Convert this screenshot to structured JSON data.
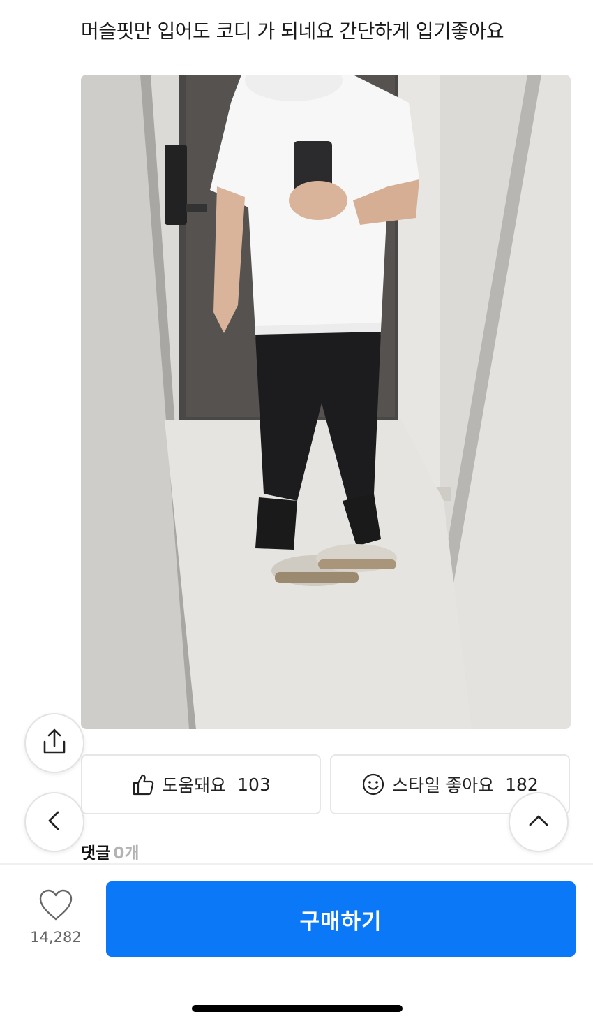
{
  "review": {
    "text": "머슬핏만 입어도 코디 가 되네요 간단하게 입기좋아요"
  },
  "reactions": {
    "helpful": {
      "label": "도움돼요",
      "count": "103",
      "icon": "thumbs-up-icon"
    },
    "style": {
      "label": "스타일 좋아요",
      "count": "182",
      "icon": "smiley-icon"
    }
  },
  "comments": {
    "label": "댓글",
    "count": "0개"
  },
  "floating": {
    "share_icon": "share-icon",
    "back_icon": "chevron-left-icon",
    "top_icon": "chevron-up-icon"
  },
  "bottom": {
    "like_count": "14,282",
    "like_icon": "heart-icon",
    "buy_label": "구매하기"
  },
  "colors": {
    "accent": "#0b78f7",
    "muted": "#b3b3b3"
  }
}
